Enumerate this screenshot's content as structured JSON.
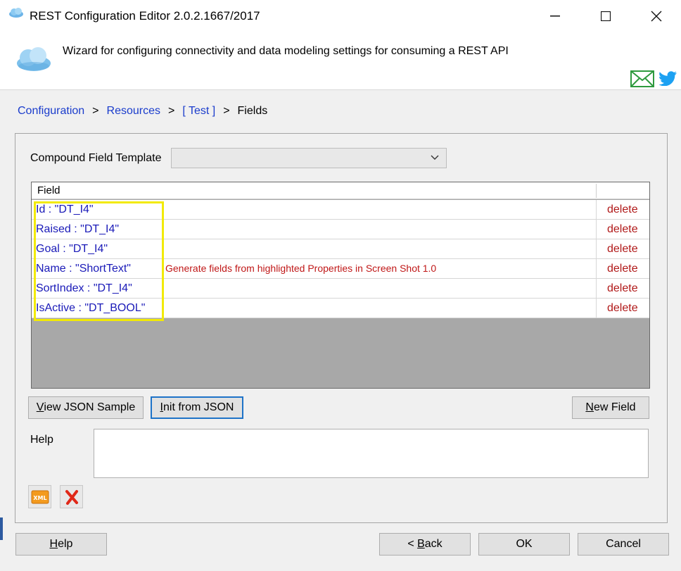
{
  "window": {
    "title": "REST Configuration Editor 2.0.2.1667/2017",
    "minimize_glyph": "—",
    "maximize_glyph": "☐",
    "close_glyph": "✕"
  },
  "header": {
    "description": "Wizard for configuring connectivity and data modeling settings for consuming a REST API",
    "icons": [
      "cloud-icon",
      "mail-icon",
      "twitter-icon"
    ]
  },
  "breadcrumb": {
    "items": [
      "Configuration",
      "Resources",
      "[ Test ]"
    ],
    "current": "Fields",
    "separator": ">"
  },
  "compound": {
    "label": "Compound Field Template",
    "value": ""
  },
  "grid": {
    "column_header": "Field",
    "rows": [
      {
        "field": "Id : \"DT_I4\"",
        "action": "delete"
      },
      {
        "field": "Raised : \"DT_I4\"",
        "action": "delete"
      },
      {
        "field": "Goal : \"DT_I4\"",
        "action": "delete"
      },
      {
        "field": "Name : \"ShortText\"",
        "action": "delete"
      },
      {
        "field": "SortIndex : \"DT_I4\"",
        "action": "delete"
      },
      {
        "field": "IsActive : \"DT_BOOL\"",
        "action": "delete"
      }
    ],
    "annotation": "Generate fields from highlighted Properties in Screen Shot 1.0",
    "highlight_color": "#f2ea06"
  },
  "buttons": {
    "view_json": {
      "mnemonic": "V",
      "rest": "iew JSON Sample"
    },
    "init_json": {
      "mnemonic": "I",
      "rest": "nit from JSON"
    },
    "new_field": {
      "mnemonic": "N",
      "rest": "ew Field"
    }
  },
  "help": {
    "label": "Help",
    "value": ""
  },
  "footer": {
    "help": {
      "mnemonic": "H",
      "rest": "elp"
    },
    "back": {
      "prefix": "< ",
      "mnemonic": "B",
      "rest": "ack"
    },
    "ok": "OK",
    "cancel": "Cancel"
  },
  "colors": {
    "link": "#1a3ccc",
    "delete": "#b01818",
    "field_text": "#1a1ab8",
    "focus": "#1e73c8"
  }
}
